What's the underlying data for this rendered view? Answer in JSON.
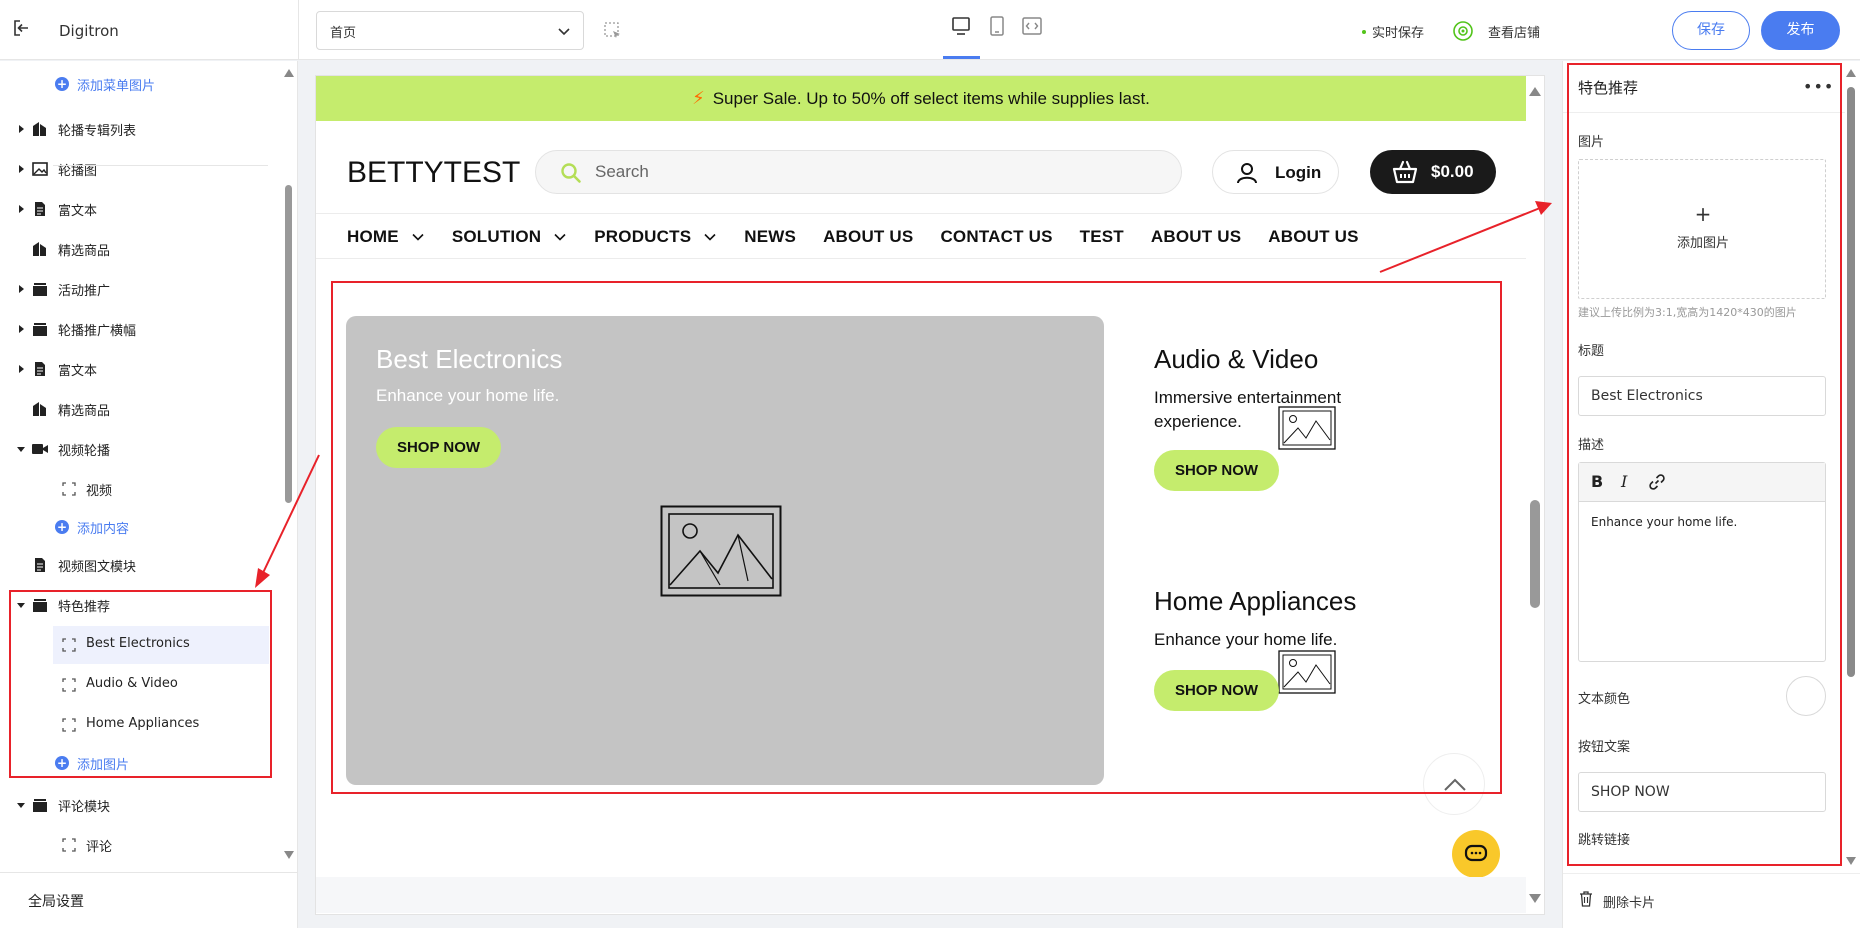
{
  "topbar": {
    "app_name": "Digitron",
    "page_select": "首页",
    "autosave": "实时保存",
    "view_store": "查看店铺",
    "save": "保存",
    "publish": "发布"
  },
  "sidebar": {
    "items": [
      {
        "label": "添加菜单图片",
        "type": "add"
      },
      {
        "label": "轮播专辑列表",
        "icon": "tag-icon",
        "caret": "right"
      },
      {
        "label": "轮播图",
        "icon": "image-icon",
        "caret": "right"
      },
      {
        "label": "富文本",
        "icon": "doc-icon",
        "caret": "right"
      },
      {
        "label": "精选商品",
        "icon": "tag-icon"
      },
      {
        "label": "活动推广",
        "icon": "stack-icon",
        "caret": "right"
      },
      {
        "label": "轮播推广横幅",
        "icon": "stack-icon",
        "caret": "right"
      },
      {
        "label": "富文本",
        "icon": "doc-icon",
        "caret": "right"
      },
      {
        "label": "精选商品",
        "icon": "tag-icon"
      },
      {
        "label": "视频轮播",
        "icon": "video-icon",
        "caret": "down"
      },
      {
        "label": "视频",
        "icon": "frame-icon"
      },
      {
        "label": "添加内容",
        "type": "add"
      },
      {
        "label": "视频图文模块",
        "icon": "doc-icon"
      },
      {
        "label": "特色推荐",
        "icon": "stack-icon",
        "caret": "down"
      },
      {
        "label": "Best Electronics",
        "icon": "frame-icon",
        "selected": true
      },
      {
        "label": "Audio & Video",
        "icon": "frame-icon"
      },
      {
        "label": "Home Appliances",
        "icon": "frame-icon"
      },
      {
        "label": "添加图片",
        "type": "add"
      },
      {
        "label": "评论模块",
        "icon": "stack-icon",
        "caret": "down"
      },
      {
        "label": "评论",
        "icon": "frame-icon"
      }
    ],
    "global_settings": "全局设置"
  },
  "store": {
    "announcement": "Super Sale. Up to 50% off select items while supplies last.",
    "logo": "BETTYTEST",
    "search_placeholder": "Search",
    "login": "Login",
    "cart": "$0.00",
    "nav": [
      {
        "label": "HOME",
        "dropdown": true
      },
      {
        "label": "SOLUTION",
        "dropdown": true
      },
      {
        "label": "PRODUCTS",
        "dropdown": true
      },
      {
        "label": "NEWS"
      },
      {
        "label": "ABOUT US"
      },
      {
        "label": "CONTACT US"
      },
      {
        "label": "TEST"
      },
      {
        "label": "ABOUT US"
      },
      {
        "label": "ABOUT US"
      }
    ],
    "cards": [
      {
        "title": "Best Electronics",
        "desc": "Enhance your home life.",
        "button": "SHOP NOW"
      },
      {
        "title": "Audio & Video",
        "desc": "Immersive entertainment experience.",
        "button": "SHOP NOW"
      },
      {
        "title": "Home Appliances",
        "desc": "Enhance your home life.",
        "button": "SHOP NOW"
      }
    ]
  },
  "panel": {
    "title": "特色推荐",
    "more": "•••",
    "image_label": "图片",
    "add_image": "添加图片",
    "upload_plus": "+",
    "image_hint": "建议上传比例为3:1,宽高为1420*430的图片",
    "title_label": "标题",
    "title_value": "Best Electronics",
    "desc_label": "描述",
    "desc_value": "Enhance your home life.",
    "text_color_label": "文本颜色",
    "button_text_label": "按钮文案",
    "button_text_value": "SHOP NOW",
    "link_label": "跳转链接",
    "delete_card": "删除卡片"
  },
  "colors": {
    "accent": "#4a7cf0",
    "announcement_bg": "#c5ec6d",
    "shop_button": "#c5ec6d",
    "annotation": "#e8222a",
    "chat_button": "#f9c82a"
  }
}
